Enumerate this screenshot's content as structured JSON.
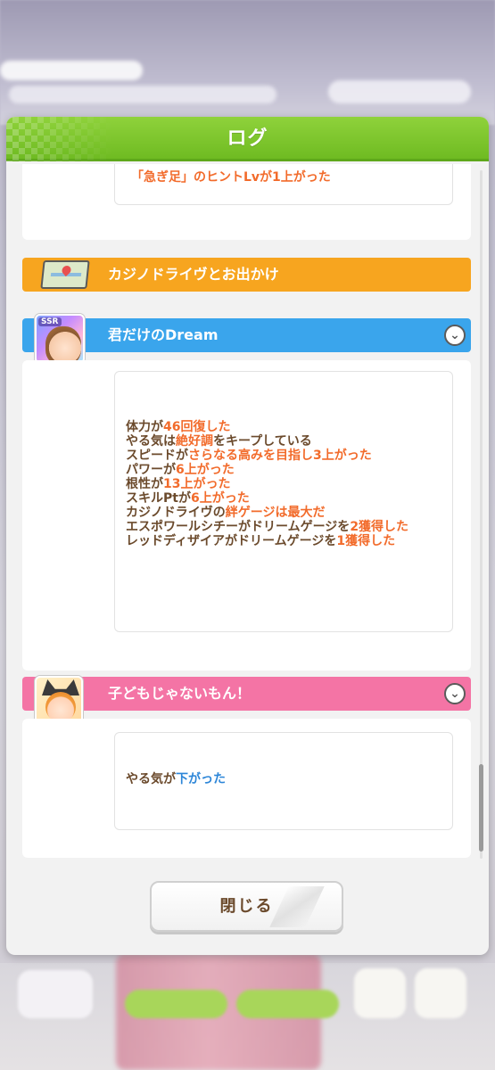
{
  "modal": {
    "title": "ログ",
    "close_label": "閉じる"
  },
  "entries": {
    "first_card": {
      "line": "「急ぎ足」のヒントLvが1上がった"
    },
    "outing_event": {
      "label": "カジノドライヴとお出かけ",
      "icon": "map-icon"
    },
    "dream_event": {
      "label": "君だけのDream",
      "portrait_badge": "SSR",
      "lines": [
        {
          "prefix": "体力が",
          "value": "46回復した",
          "suffix": ""
        },
        {
          "prefix": "やる気は",
          "value": "絶好調",
          "suffix": "をキープしている"
        },
        {
          "prefix": "スピードが",
          "value": "さらなる高みを目指し3上がった",
          "suffix": ""
        },
        {
          "prefix": "パワーが",
          "value": "6上がった",
          "suffix": ""
        },
        {
          "prefix": "根性が",
          "value": "13上がった",
          "suffix": ""
        },
        {
          "prefix": "スキルPtが",
          "value": "6上がった",
          "suffix": ""
        },
        {
          "prefix": "カジノドライヴの",
          "value": "絆ゲージは最大だ",
          "suffix": ""
        },
        {
          "prefix": "エスポワールシチーがドリームゲージを",
          "value": "2獲得した",
          "suffix": ""
        },
        {
          "prefix": "レッドディザイアがドリームゲージを",
          "value": "1獲得した",
          "suffix": ""
        }
      ]
    },
    "kid_event": {
      "label": "子どもじゃないもん！",
      "line_prefix": "やる気が",
      "line_value": "下がった"
    }
  },
  "colors": {
    "header_green": "#7cc62c",
    "orange_bar": "#f7a51f",
    "blue_bar": "#3aa5ec",
    "pink_bar": "#f474a5",
    "highlight_orange": "#f26b2b",
    "highlight_blue": "#2d86d8",
    "text_brown": "#6b4a2c"
  }
}
